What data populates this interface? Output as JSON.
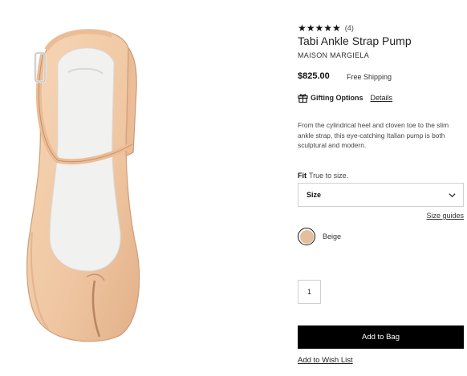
{
  "product": {
    "stars": "★★★★★",
    "review_count": "4",
    "title": "Tabi Ankle Strap Pump",
    "brand": "MAISON MARGIELA",
    "price": "$825.00",
    "shipping": "Free Shipping",
    "gifting_label": "Gifting Options",
    "details_link": "Details",
    "description": "From the cylindrical heel and cloven toe to the slim ankle strap, this eye-catching Italian pump is both sculptural and modern.",
    "fit_label": "Fit",
    "fit_value": "True to size.",
    "size_select": "Size",
    "size_guides": "Size guides",
    "color_name": "Beige",
    "quantity": "1",
    "add_to_bag": "Add to Bag",
    "wish_list": "Add to Wish List"
  },
  "colors": {
    "beige_swatch": "#e3bf9c",
    "shoe_leather": "#efc8a4",
    "button_bg": "#000000"
  },
  "icons": [
    "gift-icon",
    "chevron-down-icon"
  ]
}
